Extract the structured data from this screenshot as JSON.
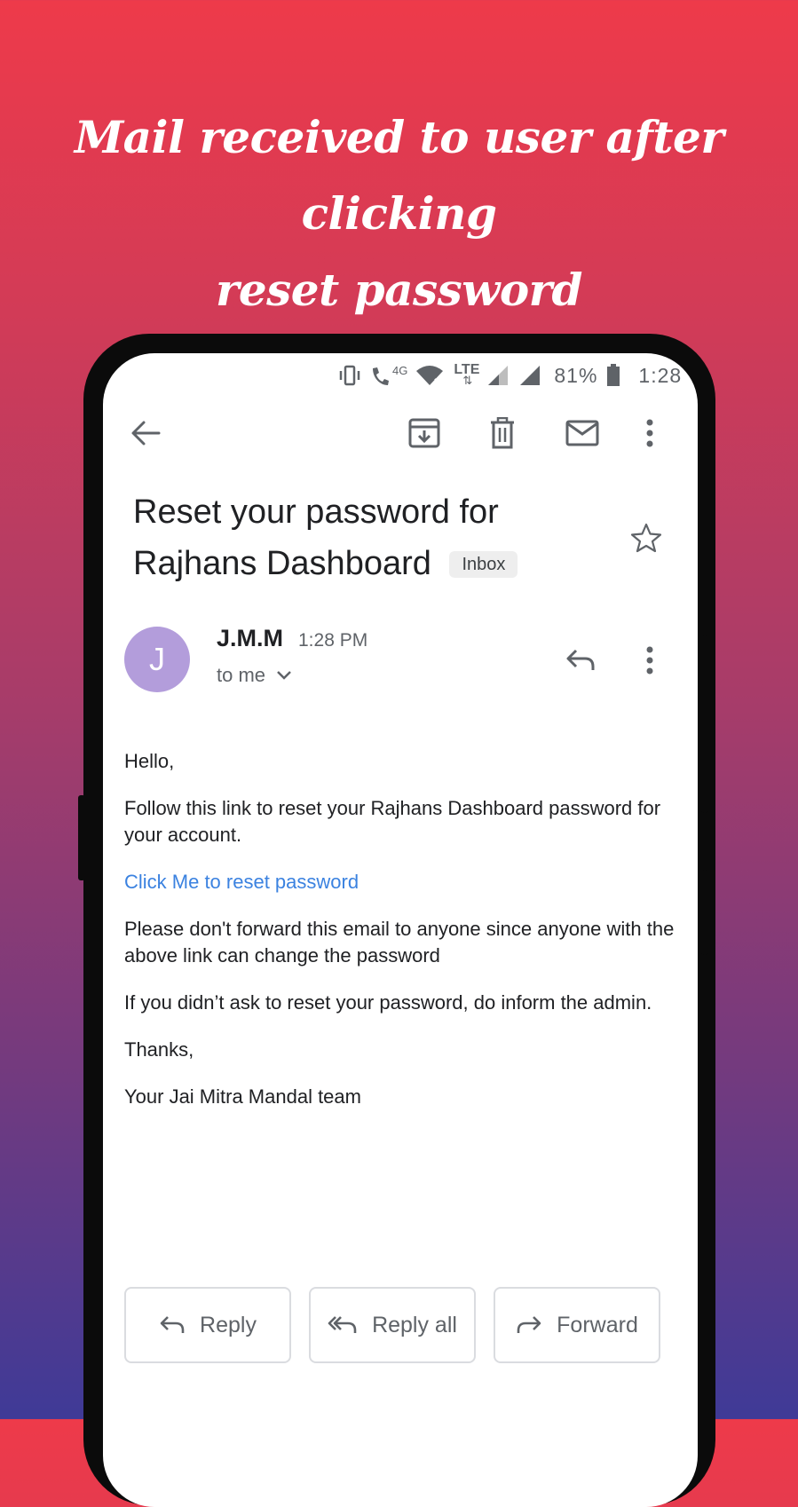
{
  "headline": {
    "line1": "Mail received to user after clicking",
    "line2": "reset password"
  },
  "status_bar": {
    "network_4g": "4G",
    "network_lte": "LTE",
    "battery": "81%",
    "time": "1:28",
    "icons": [
      "vibrate-icon",
      "wifi-call-icon",
      "wifi-icon",
      "lte-icon",
      "signal-icon",
      "signal-icon",
      "battery-icon"
    ]
  },
  "toolbar": {
    "icons": [
      "back-arrow-icon",
      "archive-icon",
      "delete-icon",
      "mark-unread-icon",
      "more-vert-icon"
    ]
  },
  "email": {
    "subject": "Reset your password for Rajhans Dashboard",
    "label": "Inbox",
    "avatar_letter": "J",
    "avatar_color": "#b39ddb",
    "sender": "J.M.M",
    "time": "1:28 PM",
    "recipient": "to me",
    "body": {
      "greeting": "Hello,",
      "para1": "Follow this link to reset your Rajhans Dashboard password for your account.",
      "link": "Click Me to reset password",
      "para2": "Please don't forward this email to anyone since anyone with the above link can change the password",
      "para3": "If you didn’t ask to reset your password, do inform the admin.",
      "thanks": "Thanks,",
      "signature": "Your Jai Mitra Mandal team"
    }
  },
  "actions": {
    "reply": "Reply",
    "reply_all": "Reply all",
    "forward": "Forward"
  },
  "colors": {
    "link": "#3b82e0",
    "gradient_top": "#ee3a4a",
    "gradient_bottom": "#3f3a97"
  }
}
